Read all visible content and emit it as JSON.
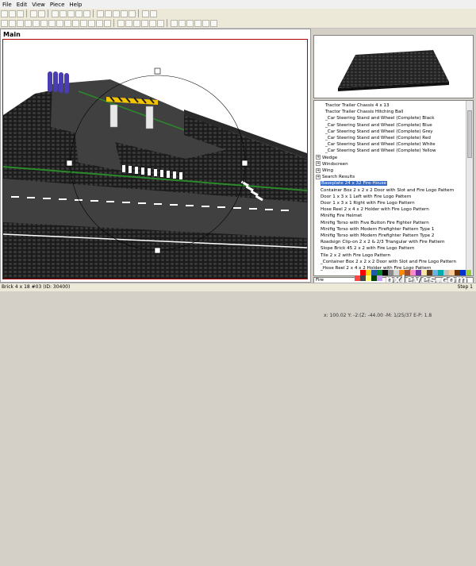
{
  "menu": [
    "File",
    "Edit",
    "View",
    "Piece",
    "Help"
  ],
  "view": {
    "title": "Main"
  },
  "tree": {
    "rows": [
      {
        "label": "Tractor Trailer Chassis 4 x 13",
        "indent": 2,
        "expander": false
      },
      {
        "label": "Tractor Trailer Chassis Hitching Ball",
        "indent": 2,
        "expander": false
      },
      {
        "label": "_Car Steering Stand and Wheel (Complete) Black",
        "indent": 2,
        "expander": false
      },
      {
        "label": "_Car Steering Stand and Wheel (Complete) Blue",
        "indent": 2,
        "expander": false
      },
      {
        "label": "_Car Steering Stand and Wheel (Complete) Grey",
        "indent": 2,
        "expander": false
      },
      {
        "label": "_Car Steering Stand and Wheel (Complete) Red",
        "indent": 2,
        "expander": false
      },
      {
        "label": "_Car Steering Stand and Wheel (Complete) White",
        "indent": 2,
        "expander": false
      },
      {
        "label": "_Car Steering Stand and Wheel (Complete) Yellow",
        "indent": 2,
        "expander": false
      },
      {
        "label": "Wedge",
        "indent": 0,
        "expander": true
      },
      {
        "label": "Windscreen",
        "indent": 0,
        "expander": true
      },
      {
        "label": "Wing",
        "indent": 0,
        "expander": true
      },
      {
        "label": "Search Results",
        "indent": 0,
        "expander": true
      },
      {
        "label": "Baseplate 24 x 32 Fire-House",
        "indent": 1,
        "expander": false,
        "selected": true
      },
      {
        "label": "Container Box 2 x 2 x 2 Door with Slot and Fire Logo Pattern",
        "indent": 1,
        "expander": false
      },
      {
        "label": "Door 1 x 3 x 1 Left with Fire Logo Pattern",
        "indent": 1,
        "expander": false
      },
      {
        "label": "Door 1 x 3 x 1 Right with Fire Logo Pattern",
        "indent": 1,
        "expander": false
      },
      {
        "label": "Hose Reel 2 x 4 x 2 Holder with Fire Logo Pattern",
        "indent": 1,
        "expander": false
      },
      {
        "label": "Minifig Fire Helmet",
        "indent": 1,
        "expander": false
      },
      {
        "label": "Minifig Torso with Five Button Fire Fighter Pattern",
        "indent": 1,
        "expander": false
      },
      {
        "label": "Minifig Torso with Modern Firefighter Pattern Type 1",
        "indent": 1,
        "expander": false
      },
      {
        "label": "Minifig Torso with Modern Firefighter Pattern Type 2",
        "indent": 1,
        "expander": false
      },
      {
        "label": "Roadsign Clip-on 2 x 2 & 2/3 Triangular with Fire Pattern",
        "indent": 1,
        "expander": false
      },
      {
        "label": "Slope Brick 45 2 x 2 with Fire Logo Pattern",
        "indent": 1,
        "expander": false
      },
      {
        "label": "Tile 2 x 2 with Fire Logo Pattern",
        "indent": 1,
        "expander": false
      },
      {
        "label": "_Container Box 2 x 2 x 2 Door with Slot and Fire Logo Pattern",
        "indent": 1,
        "expander": false
      },
      {
        "label": "_Hose Reel 2 x 4 x 2 Holder with Fire Logo Pattern",
        "indent": 1,
        "expander": false
      }
    ]
  },
  "filter": {
    "value": "Fire"
  },
  "palette": [
    "#ffffff",
    "#ff0000",
    "#ffd800",
    "#1e5aa8",
    "#00852b",
    "#000000",
    "#8a8a8a",
    "#d4d4d4",
    "#ff8800",
    "#a05028",
    "#ff88cc",
    "#7030a0",
    "#f5e6a0",
    "#5a3a1a",
    "#6cb4e4",
    "#00aaaa",
    "#c0c0c0",
    "#ffcc99",
    "#663300",
    "#0033cc",
    "#99cc33",
    "#ff4444",
    "#444444",
    "#ffff66",
    "#004400",
    "#cc99ff"
  ],
  "status": {
    "left": "Brick 4 x 18 #03 (ID: 30400)",
    "right": "x: 100.02 Y: -2:(Z: -44.00    -M: 1/25/37 E-P: 1.8",
    "step": "Step 1"
  },
  "watermark": "pxleyes.com"
}
